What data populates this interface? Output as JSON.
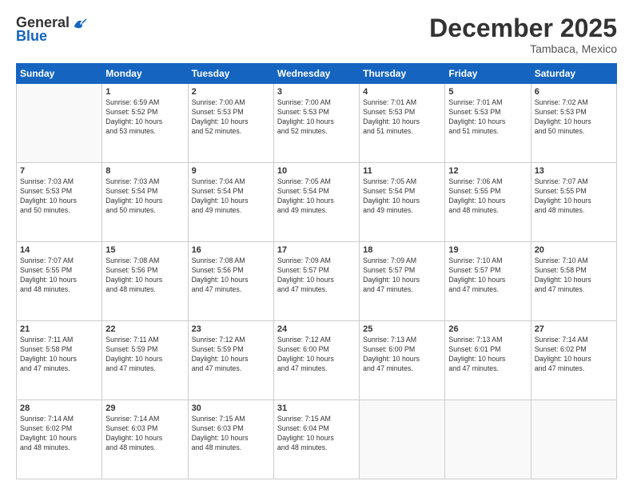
{
  "logo": {
    "general": "General",
    "blue": "Blue"
  },
  "title": "December 2025",
  "location": "Tambaca, Mexico",
  "days_header": [
    "Sunday",
    "Monday",
    "Tuesday",
    "Wednesday",
    "Thursday",
    "Friday",
    "Saturday"
  ],
  "weeks": [
    [
      {
        "day": "",
        "info": ""
      },
      {
        "day": "1",
        "info": "Sunrise: 6:59 AM\nSunset: 5:52 PM\nDaylight: 10 hours\nand 53 minutes."
      },
      {
        "day": "2",
        "info": "Sunrise: 7:00 AM\nSunset: 5:53 PM\nDaylight: 10 hours\nand 52 minutes."
      },
      {
        "day": "3",
        "info": "Sunrise: 7:00 AM\nSunset: 5:53 PM\nDaylight: 10 hours\nand 52 minutes."
      },
      {
        "day": "4",
        "info": "Sunrise: 7:01 AM\nSunset: 5:53 PM\nDaylight: 10 hours\nand 51 minutes."
      },
      {
        "day": "5",
        "info": "Sunrise: 7:01 AM\nSunset: 5:53 PM\nDaylight: 10 hours\nand 51 minutes."
      },
      {
        "day": "6",
        "info": "Sunrise: 7:02 AM\nSunset: 5:53 PM\nDaylight: 10 hours\nand 50 minutes."
      }
    ],
    [
      {
        "day": "7",
        "info": "Sunrise: 7:03 AM\nSunset: 5:53 PM\nDaylight: 10 hours\nand 50 minutes."
      },
      {
        "day": "8",
        "info": "Sunrise: 7:03 AM\nSunset: 5:54 PM\nDaylight: 10 hours\nand 50 minutes."
      },
      {
        "day": "9",
        "info": "Sunrise: 7:04 AM\nSunset: 5:54 PM\nDaylight: 10 hours\nand 49 minutes."
      },
      {
        "day": "10",
        "info": "Sunrise: 7:05 AM\nSunset: 5:54 PM\nDaylight: 10 hours\nand 49 minutes."
      },
      {
        "day": "11",
        "info": "Sunrise: 7:05 AM\nSunset: 5:54 PM\nDaylight: 10 hours\nand 49 minutes."
      },
      {
        "day": "12",
        "info": "Sunrise: 7:06 AM\nSunset: 5:55 PM\nDaylight: 10 hours\nand 48 minutes."
      },
      {
        "day": "13",
        "info": "Sunrise: 7:07 AM\nSunset: 5:55 PM\nDaylight: 10 hours\nand 48 minutes."
      }
    ],
    [
      {
        "day": "14",
        "info": "Sunrise: 7:07 AM\nSunset: 5:55 PM\nDaylight: 10 hours\nand 48 minutes."
      },
      {
        "day": "15",
        "info": "Sunrise: 7:08 AM\nSunset: 5:56 PM\nDaylight: 10 hours\nand 48 minutes."
      },
      {
        "day": "16",
        "info": "Sunrise: 7:08 AM\nSunset: 5:56 PM\nDaylight: 10 hours\nand 47 minutes."
      },
      {
        "day": "17",
        "info": "Sunrise: 7:09 AM\nSunset: 5:57 PM\nDaylight: 10 hours\nand 47 minutes."
      },
      {
        "day": "18",
        "info": "Sunrise: 7:09 AM\nSunset: 5:57 PM\nDaylight: 10 hours\nand 47 minutes."
      },
      {
        "day": "19",
        "info": "Sunrise: 7:10 AM\nSunset: 5:57 PM\nDaylight: 10 hours\nand 47 minutes."
      },
      {
        "day": "20",
        "info": "Sunrise: 7:10 AM\nSunset: 5:58 PM\nDaylight: 10 hours\nand 47 minutes."
      }
    ],
    [
      {
        "day": "21",
        "info": "Sunrise: 7:11 AM\nSunset: 5:58 PM\nDaylight: 10 hours\nand 47 minutes."
      },
      {
        "day": "22",
        "info": "Sunrise: 7:11 AM\nSunset: 5:59 PM\nDaylight: 10 hours\nand 47 minutes."
      },
      {
        "day": "23",
        "info": "Sunrise: 7:12 AM\nSunset: 5:59 PM\nDaylight: 10 hours\nand 47 minutes."
      },
      {
        "day": "24",
        "info": "Sunrise: 7:12 AM\nSunset: 6:00 PM\nDaylight: 10 hours\nand 47 minutes."
      },
      {
        "day": "25",
        "info": "Sunrise: 7:13 AM\nSunset: 6:00 PM\nDaylight: 10 hours\nand 47 minutes."
      },
      {
        "day": "26",
        "info": "Sunrise: 7:13 AM\nSunset: 6:01 PM\nDaylight: 10 hours\nand 47 minutes."
      },
      {
        "day": "27",
        "info": "Sunrise: 7:14 AM\nSunset: 6:02 PM\nDaylight: 10 hours\nand 47 minutes."
      }
    ],
    [
      {
        "day": "28",
        "info": "Sunrise: 7:14 AM\nSunset: 6:02 PM\nDaylight: 10 hours\nand 48 minutes."
      },
      {
        "day": "29",
        "info": "Sunrise: 7:14 AM\nSunset: 6:03 PM\nDaylight: 10 hours\nand 48 minutes."
      },
      {
        "day": "30",
        "info": "Sunrise: 7:15 AM\nSunset: 6:03 PM\nDaylight: 10 hours\nand 48 minutes."
      },
      {
        "day": "31",
        "info": "Sunrise: 7:15 AM\nSunset: 6:04 PM\nDaylight: 10 hours\nand 48 minutes."
      },
      {
        "day": "",
        "info": ""
      },
      {
        "day": "",
        "info": ""
      },
      {
        "day": "",
        "info": ""
      }
    ]
  ]
}
